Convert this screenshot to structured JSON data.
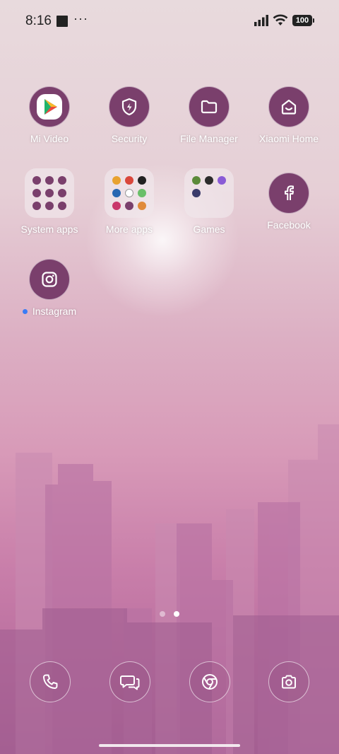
{
  "status_bar": {
    "time": "8:16",
    "notification_more": "···",
    "battery": "100"
  },
  "apps": [
    {
      "label": "Mi Video",
      "icon": "mi-video-icon"
    },
    {
      "label": "Security",
      "icon": "shield-lightning-icon"
    },
    {
      "label": "File Manager",
      "icon": "folder-icon"
    },
    {
      "label": "Xiaomi Home",
      "icon": "home-smile-icon"
    },
    {
      "label": "System apps",
      "icon": "folder-grid-icon"
    },
    {
      "label": "More apps",
      "icon": "folder-grid-icon"
    },
    {
      "label": "Games",
      "icon": "folder-grid-icon"
    },
    {
      "label": "Facebook",
      "icon": "facebook-icon"
    },
    {
      "label": "Instagram",
      "icon": "instagram-icon",
      "badge": "new-install-dot"
    }
  ],
  "page_indicator": {
    "pages": 2,
    "current": 2
  },
  "dock": [
    {
      "name": "phone",
      "icon": "phone-icon"
    },
    {
      "name": "messages",
      "icon": "messages-icon"
    },
    {
      "name": "chrome",
      "icon": "chrome-icon"
    },
    {
      "name": "camera",
      "icon": "camera-icon"
    }
  ],
  "colors": {
    "icon_bg": "#7a3f6c",
    "accent_dot": "#3a7cf5"
  }
}
